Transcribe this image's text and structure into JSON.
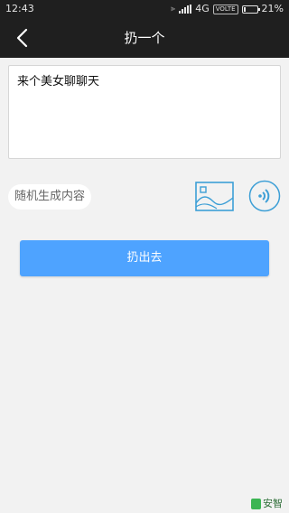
{
  "status_bar": {
    "time": "12:43",
    "network": "4G",
    "volte": "VOLTE",
    "battery": "21%",
    "battery_level": 0.21
  },
  "nav": {
    "title": "扔一个",
    "back_icon": "chevron-left-icon"
  },
  "compose": {
    "text": "来个美女聊聊天"
  },
  "actions": {
    "random_label": "随机生成内容",
    "image_icon": "image-icon",
    "voice_icon": "voice-icon"
  },
  "submit": {
    "label": "扔出去"
  },
  "watermark": {
    "brand": "安智"
  },
  "colors": {
    "primary": "#4ea3ff",
    "icon_blue": "#3d9fd6",
    "bar_bg": "#1f1f1f",
    "page_bg": "#f2f2f2"
  }
}
